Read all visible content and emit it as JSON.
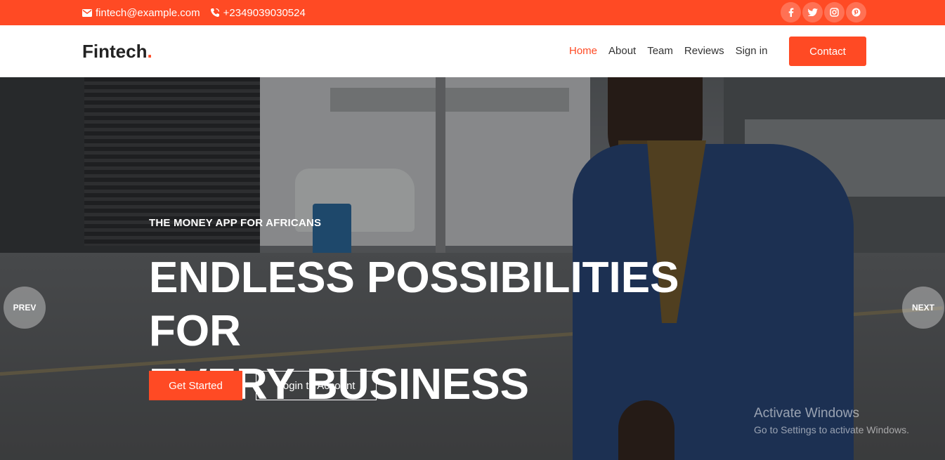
{
  "topbar": {
    "email": "fintech@example.com",
    "phone": "+2349039030524",
    "socials": [
      "facebook-icon",
      "twitter-icon",
      "instagram-icon",
      "pinterest-icon"
    ]
  },
  "header": {
    "logo_text": "Fintech",
    "logo_dot": ".",
    "nav": [
      {
        "label": "Home"
      },
      {
        "label": "About"
      },
      {
        "label": "Team"
      },
      {
        "label": "Reviews"
      },
      {
        "label": "Sign in"
      }
    ],
    "contact_label": "Contact"
  },
  "hero": {
    "eyebrow": "THE MONEY APP FOR AFRICANS",
    "headline_line1": "ENDLESS POSSIBILITIES FOR",
    "headline_line2": "EVERY BUSINESS",
    "primary_label": "Get Started",
    "secondary_label": "Login to Account",
    "prev_label": "PREV",
    "next_label": "NEXT"
  },
  "watermark": {
    "title": "Activate Windows",
    "subtitle": "Go to Settings to activate Windows."
  },
  "colors": {
    "accent": "#ff4a24",
    "text_dark": "#222222"
  }
}
